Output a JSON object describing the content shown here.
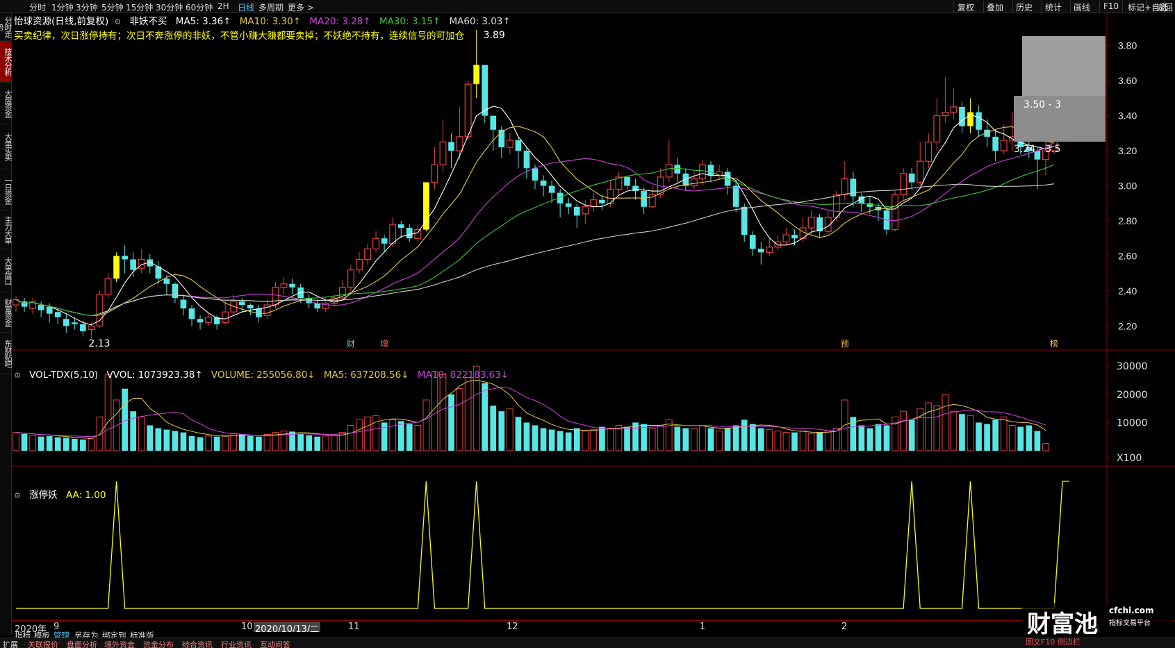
{
  "topbar": {
    "periods": [
      "分时",
      "1分钟",
      "3分钟",
      "5分钟",
      "15分钟",
      "30分钟",
      "60分钟",
      "2H",
      "日线",
      "多周期",
      "更多 >"
    ],
    "active_period": "日线",
    "right_buttons": [
      "复权",
      "叠加",
      "历史",
      "统计",
      "画线",
      "F10",
      "标记",
      "+自选",
      "返回"
    ]
  },
  "left_tabs": [
    "分时走势",
    "技术分析",
    "大盘资金",
    "大单买卖",
    "一日资金",
    "主力大单",
    "大单盘口",
    "财富资金",
    "东财贴吧"
  ],
  "left_tab_active": "技术分析",
  "main_legend": {
    "stock": "怡球资源(日线,前复权)",
    "indicator": "非妖不买",
    "ma5": "MA5: 3.36↑",
    "ma10": "MA10: 3.30↑",
    "ma20": "MA20: 3.28↑",
    "ma30": "MA30: 3.15↑",
    "ma60": "MA60: 3.03↑",
    "note": "买卖纪律，次日涨停持有；次日不奔涨停的非妖，不管小赚大赚都要卖掉；不妖绝不持有，连续信号的可加仓"
  },
  "price_axis": [
    "3.80",
    "3.60",
    "3.40",
    "3.20",
    "3.00",
    "2.80",
    "2.60",
    "2.40",
    "2.20"
  ],
  "price_annotations": {
    "high": "3.89",
    "low": "2.13",
    "range1": "3.50 - 3",
    "range2": "3.24 - 3.5"
  },
  "event_markers": [
    "财",
    "增",
    "预",
    "榜"
  ],
  "vol_legend": {
    "name": "VOL-TDX(5,10)",
    "vvol": "VVOL: 1073923.38↑",
    "volume": "VOLUME: 255056.80↓",
    "ma5": "MA5: 637208.56↓",
    "ma10": "MA10: 822183.63↓"
  },
  "vol_axis": [
    "30000",
    "20000",
    "10000",
    "X100"
  ],
  "zt_legend": {
    "name": "涨停妖",
    "aa": "AA: 1.00"
  },
  "date_labels": [
    "2020年",
    "9",
    "10",
    "2020/10/13/二",
    "11",
    "12",
    "1",
    "2",
    "日线"
  ],
  "toolbar2": [
    "指标",
    "模板",
    "管理",
    "另存为",
    "绑定到",
    "标准版"
  ],
  "toolbar2_active": "管理",
  "bottombar": [
    "扩展",
    "关联报价",
    "盘面分析",
    "境外资金",
    "资金分布",
    "综合资讯",
    "行业资讯",
    "互动问答"
  ],
  "watermark": {
    "brand": "财富池",
    "site": "cfchi.com",
    "slogan": "指标交易平台",
    "footer": "图文F10 侧边栏"
  },
  "colors": {
    "up": "#e84040",
    "down": "#55e6e6",
    "signal": "#ffff00",
    "ma5": "#ffffff",
    "ma10": "#e6c84a",
    "ma20": "#d040e0",
    "ma30": "#3cc43c",
    "ma60": "#cfcfcf"
  },
  "chart_data": {
    "type": "candlestick",
    "x_range": [
      "2020-09",
      "2021-02"
    ],
    "ylim": [
      2.1,
      3.9
    ],
    "candles": [
      [
        2.32,
        2.35,
        2.28,
        2.37
      ],
      [
        2.34,
        2.31,
        2.28,
        2.36
      ],
      [
        2.3,
        2.34,
        2.27,
        2.36
      ],
      [
        2.32,
        2.29,
        2.25,
        2.34
      ],
      [
        2.31,
        2.27,
        2.22,
        2.33
      ],
      [
        2.28,
        2.25,
        2.21,
        2.3
      ],
      [
        2.24,
        2.2,
        2.16,
        2.27
      ],
      [
        2.22,
        2.21,
        2.18,
        2.25
      ],
      [
        2.21,
        2.17,
        2.14,
        2.23
      ],
      [
        2.18,
        2.2,
        2.13,
        2.22
      ],
      [
        2.2,
        2.38,
        2.19,
        2.4
      ],
      [
        2.38,
        2.47,
        2.36,
        2.5
      ],
      [
        2.47,
        2.6,
        2.45,
        2.62
      ],
      [
        2.6,
        2.58,
        2.5,
        2.66
      ],
      [
        2.58,
        2.52,
        2.48,
        2.62
      ],
      [
        2.53,
        2.58,
        2.5,
        2.64
      ],
      [
        2.58,
        2.54,
        2.5,
        2.61
      ],
      [
        2.54,
        2.47,
        2.44,
        2.57
      ],
      [
        2.47,
        2.44,
        2.38,
        2.49
      ],
      [
        2.44,
        2.36,
        2.33,
        2.45
      ],
      [
        2.35,
        2.3,
        2.26,
        2.38
      ],
      [
        2.3,
        2.24,
        2.2,
        2.32
      ],
      [
        2.24,
        2.22,
        2.18,
        2.26
      ],
      [
        2.22,
        2.25,
        2.2,
        2.27
      ],
      [
        2.25,
        2.21,
        2.18,
        2.26
      ],
      [
        2.22,
        2.28,
        2.21,
        2.34
      ],
      [
        2.28,
        2.34,
        2.26,
        2.38
      ],
      [
        2.34,
        2.32,
        2.28,
        2.36
      ],
      [
        2.32,
        2.3,
        2.26,
        2.33
      ],
      [
        2.3,
        2.25,
        2.22,
        2.32
      ],
      [
        2.26,
        2.32,
        2.24,
        2.35
      ],
      [
        2.32,
        2.42,
        2.3,
        2.45
      ],
      [
        2.42,
        2.44,
        2.38,
        2.48
      ],
      [
        2.44,
        2.42,
        2.38,
        2.47
      ],
      [
        2.42,
        2.36,
        2.33,
        2.44
      ],
      [
        2.36,
        2.33,
        2.3,
        2.38
      ],
      [
        2.33,
        2.3,
        2.28,
        2.35
      ],
      [
        2.3,
        2.33,
        2.28,
        2.36
      ],
      [
        2.33,
        2.36,
        2.31,
        2.38
      ],
      [
        2.36,
        2.42,
        2.34,
        2.46
      ],
      [
        2.42,
        2.52,
        2.4,
        2.55
      ],
      [
        2.52,
        2.58,
        2.5,
        2.62
      ],
      [
        2.58,
        2.64,
        2.55,
        2.67
      ],
      [
        2.64,
        2.7,
        2.62,
        2.74
      ],
      [
        2.7,
        2.67,
        2.62,
        2.72
      ],
      [
        2.67,
        2.78,
        2.65,
        2.82
      ],
      [
        2.78,
        2.76,
        2.7,
        2.8
      ],
      [
        2.76,
        2.7,
        2.68,
        2.78
      ],
      [
        2.7,
        2.75,
        2.68,
        2.78
      ],
      [
        2.75,
        3.02,
        2.74,
        3.02
      ],
      [
        3.02,
        3.12,
        2.98,
        3.22
      ],
      [
        3.12,
        3.25,
        3.08,
        3.38
      ],
      [
        3.25,
        3.2,
        3.1,
        3.3
      ],
      [
        3.2,
        3.28,
        3.15,
        3.45
      ],
      [
        3.28,
        3.58,
        3.26,
        3.6
      ],
      [
        3.58,
        3.69,
        3.5,
        3.89
      ],
      [
        3.69,
        3.4,
        3.36,
        3.5
      ],
      [
        3.4,
        3.32,
        3.2,
        3.36
      ],
      [
        3.32,
        3.22,
        3.16,
        3.34
      ],
      [
        3.22,
        3.26,
        3.18,
        3.3
      ],
      [
        3.26,
        3.2,
        3.1,
        3.28
      ],
      [
        3.2,
        3.1,
        3.04,
        3.22
      ],
      [
        3.1,
        3.03,
        2.98,
        3.12
      ],
      [
        3.03,
        3.0,
        2.94,
        3.06
      ],
      [
        3.0,
        2.96,
        2.9,
        3.03
      ],
      [
        2.96,
        2.9,
        2.82,
        2.98
      ],
      [
        2.9,
        2.88,
        2.84,
        2.93
      ],
      [
        2.88,
        2.83,
        2.76,
        2.9
      ],
      [
        2.84,
        2.88,
        2.78,
        2.92
      ],
      [
        2.88,
        2.92,
        2.85,
        2.96
      ],
      [
        2.92,
        2.9,
        2.86,
        2.95
      ],
      [
        2.9,
        2.98,
        2.88,
        3.03
      ],
      [
        2.98,
        3.05,
        2.95,
        3.08
      ],
      [
        3.05,
        3.0,
        2.98,
        3.06
      ],
      [
        3.0,
        2.97,
        2.92,
        3.04
      ],
      [
        2.97,
        2.88,
        2.84,
        2.99
      ],
      [
        2.88,
        2.95,
        2.87,
        3.0
      ],
      [
        2.95,
        3.05,
        2.93,
        3.1
      ],
      [
        3.05,
        3.12,
        3.02,
        3.26
      ],
      [
        3.12,
        3.07,
        3.02,
        3.16
      ],
      [
        3.07,
        3.0,
        2.97,
        3.1
      ],
      [
        3.0,
        3.04,
        2.98,
        3.08
      ],
      [
        3.04,
        3.12,
        3.0,
        3.15
      ],
      [
        3.12,
        3.06,
        3.02,
        3.14
      ],
      [
        3.06,
        3.08,
        3.04,
        3.12
      ],
      [
        3.08,
        3.0,
        2.95,
        3.1
      ],
      [
        3.0,
        2.88,
        2.85,
        3.02
      ],
      [
        2.88,
        2.72,
        2.68,
        2.9
      ],
      [
        2.72,
        2.64,
        2.6,
        2.74
      ],
      [
        2.64,
        2.62,
        2.55,
        2.68
      ],
      [
        2.62,
        2.65,
        2.6,
        2.7
      ],
      [
        2.65,
        2.68,
        2.63,
        2.72
      ],
      [
        2.68,
        2.72,
        2.66,
        2.76
      ],
      [
        2.72,
        2.7,
        2.66,
        2.75
      ],
      [
        2.7,
        2.76,
        2.68,
        2.82
      ],
      [
        2.76,
        2.82,
        2.72,
        2.86
      ],
      [
        2.82,
        2.74,
        2.7,
        2.84
      ],
      [
        2.74,
        2.82,
        2.72,
        2.86
      ],
      [
        2.82,
        2.95,
        2.8,
        2.97
      ],
      [
        2.95,
        3.04,
        2.92,
        3.14
      ],
      [
        3.04,
        2.94,
        2.88,
        3.08
      ],
      [
        2.94,
        2.9,
        2.85,
        2.96
      ],
      [
        2.9,
        2.88,
        2.84,
        2.94
      ],
      [
        2.88,
        2.86,
        2.8,
        2.9
      ],
      [
        2.86,
        2.75,
        2.72,
        2.88
      ],
      [
        2.75,
        2.95,
        2.74,
        2.97
      ],
      [
        2.95,
        3.07,
        2.92,
        3.1
      ],
      [
        3.07,
        3.02,
        2.98,
        3.1
      ],
      [
        3.02,
        3.14,
        3.0,
        3.25
      ],
      [
        3.14,
        3.25,
        3.1,
        3.3
      ],
      [
        3.25,
        3.4,
        3.2,
        3.5
      ],
      [
        3.4,
        3.42,
        3.36,
        3.62
      ],
      [
        3.42,
        3.45,
        3.38,
        3.56
      ],
      [
        3.45,
        3.34,
        3.3,
        3.48
      ],
      [
        3.34,
        3.42,
        3.3,
        3.5
      ],
      [
        3.42,
        3.32,
        3.28,
        3.46
      ],
      [
        3.32,
        3.28,
        3.22,
        3.38
      ],
      [
        3.28,
        3.2,
        3.14,
        3.32
      ],
      [
        3.2,
        3.26,
        3.18,
        3.35
      ],
      [
        3.26,
        3.28,
        3.2,
        3.42
      ],
      [
        3.28,
        3.22,
        3.18,
        3.3
      ],
      [
        3.22,
        3.2,
        3.16,
        3.26
      ],
      [
        3.2,
        3.15,
        2.98,
        3.22
      ],
      [
        3.15,
        3.2,
        3.06,
        3.28
      ],
      [
        3.2,
        3.36,
        3.18,
        3.38
      ]
    ],
    "signals": [
      12,
      49,
      55,
      107,
      114,
      125
    ],
    "volume_x100": [
      6500,
      6000,
      5500,
      5000,
      5200,
      4800,
      4600,
      4200,
      4000,
      4200,
      12000,
      27000,
      18000,
      22000,
      14000,
      12000,
      9000,
      8000,
      7500,
      7000,
      6500,
      5200,
      4800,
      5200,
      5000,
      5500,
      6000,
      5800,
      5200,
      5000,
      5800,
      6500,
      7000,
      6800,
      6000,
      5500,
      5000,
      5200,
      5600,
      6500,
      9000,
      11000,
      12000,
      12500,
      10000,
      11000,
      10500,
      9500,
      9000,
      18000,
      28000,
      27000,
      20000,
      22000,
      26000,
      30000,
      24000,
      16000,
      14000,
      15000,
      12000,
      10000,
      9000,
      8000,
      7500,
      7000,
      6500,
      8000,
      7000,
      7500,
      8500,
      8000,
      9000,
      8500,
      10000,
      9500,
      8000,
      9000,
      11000,
      8500,
      8000,
      8000,
      9000,
      8000,
      7000,
      8000,
      9000,
      11000,
      9500,
      8000,
      7500,
      7000,
      6500,
      6500,
      7000,
      6000,
      6500,
      7000,
      8000,
      18000,
      12000,
      9000,
      8000,
      9500,
      9000,
      12000,
      14000,
      11000,
      15000,
      17000,
      16000,
      20000,
      14000,
      13000,
      12500,
      10000,
      9500,
      11000,
      12000,
      9000,
      8500,
      9000,
      7000,
      2551
    ],
    "ma_series_names": [
      "MA5",
      "MA10",
      "MA20",
      "MA30",
      "MA60"
    ]
  }
}
